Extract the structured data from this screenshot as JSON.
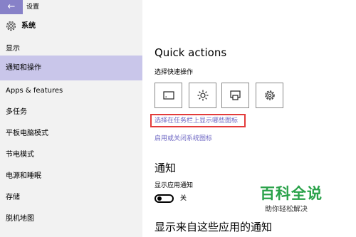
{
  "window": {
    "title": "设置"
  },
  "header": {
    "title": "系统",
    "icon": "gear-icon"
  },
  "sidebar": {
    "items": [
      {
        "label": "显示"
      },
      {
        "label": "通知和操作",
        "active": true
      },
      {
        "label": "Apps & features"
      },
      {
        "label": "多任务"
      },
      {
        "label": "平板电脑模式"
      },
      {
        "label": "节电模式"
      },
      {
        "label": "电源和睡眠"
      },
      {
        "label": "存储"
      },
      {
        "label": "脱机地图"
      }
    ]
  },
  "main": {
    "quick_actions_title": "Quick actions",
    "quick_actions_subtitle": "选择快速操作",
    "tiles": [
      {
        "icon": "tablet-mode-icon"
      },
      {
        "icon": "brightness-icon"
      },
      {
        "icon": "project-icon"
      },
      {
        "icon": "settings-icon"
      }
    ],
    "link_taskbar_icons": "选择在任务栏上显示哪些图标",
    "link_system_icons": "启用或关闭系统图标",
    "notifications_title": "通知",
    "show_app_notifications_label": "显示应用通知",
    "toggle_state_label": "关",
    "apps_notifications_title": "显示来自这些应用的通知"
  },
  "watermark": {
    "main": "百科全说",
    "sub": "助你轻松解决"
  },
  "colors": {
    "accent": "#8781c8",
    "active_nav": "#c9c6ea",
    "link": "#6f68c4",
    "highlight_box": "#e33b3b",
    "watermark": "#2aa24a"
  }
}
